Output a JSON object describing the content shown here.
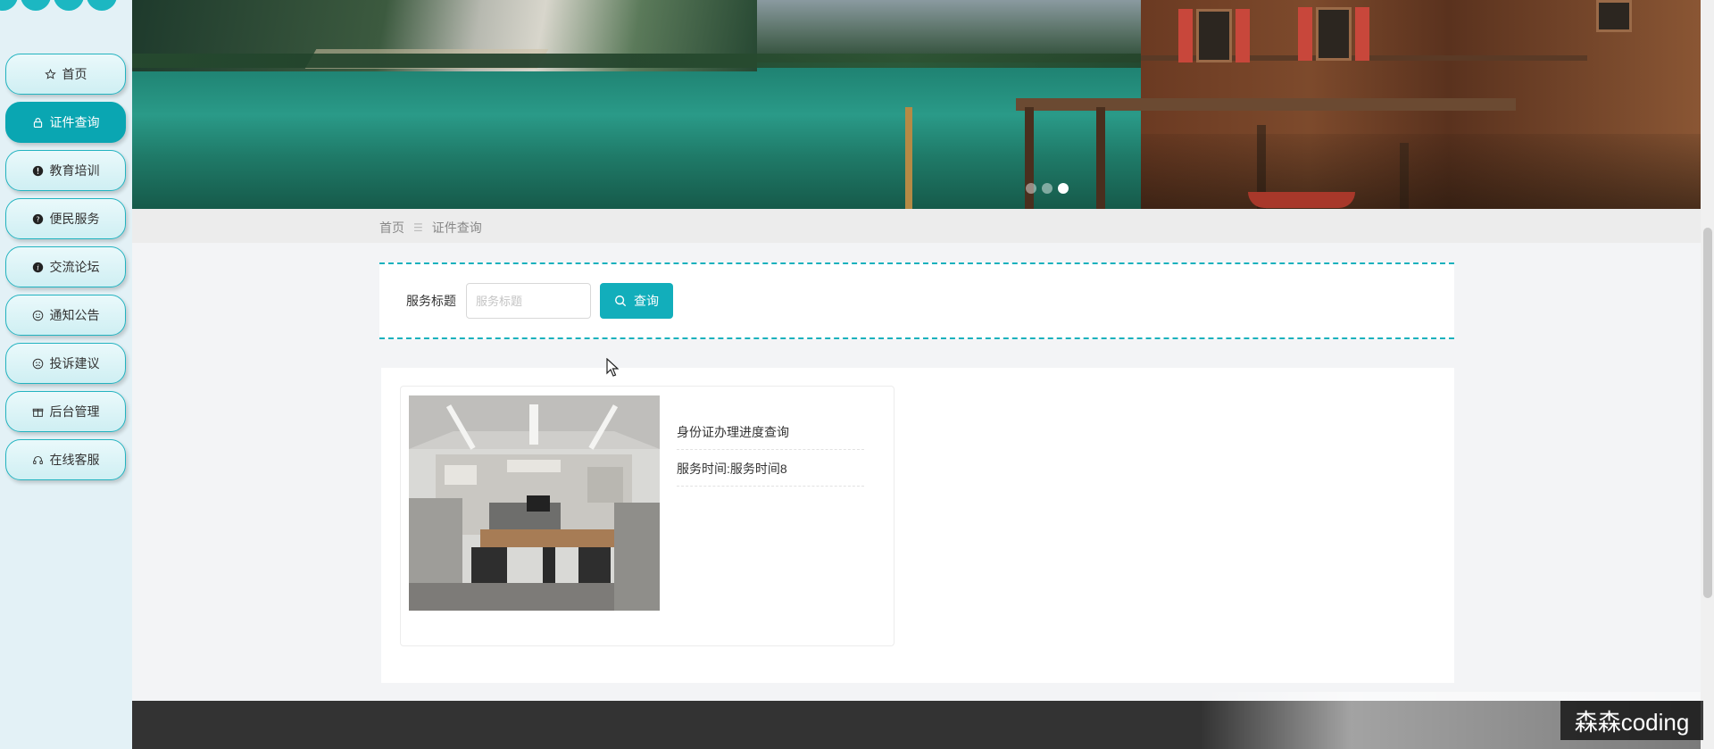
{
  "sidebar": {
    "items": [
      {
        "label": "首页",
        "icon": "star-icon"
      },
      {
        "label": "证件查询",
        "icon": "lock-icon",
        "active": true
      },
      {
        "label": "教育培训",
        "icon": "info-icon"
      },
      {
        "label": "便民服务",
        "icon": "help-icon"
      },
      {
        "label": "交流论坛",
        "icon": "info-icon"
      },
      {
        "label": "通知公告",
        "icon": "smile-icon"
      },
      {
        "label": "投诉建议",
        "icon": "feedback-icon"
      },
      {
        "label": "后台管理",
        "icon": "gift-icon"
      },
      {
        "label": "在线客服",
        "icon": "headset-icon"
      }
    ]
  },
  "breadcrumb": {
    "home": "首页",
    "separator": "☰",
    "current": "证件查询"
  },
  "search": {
    "label": "服务标题",
    "placeholder": "服务标题",
    "button_label": "查询"
  },
  "results": [
    {
      "title": "身份证办理进度查询",
      "time": "服务时间:服务时间8"
    }
  ],
  "carousel": {
    "count": 3,
    "active_index": 2
  },
  "watermark": "森森coding",
  "colors": {
    "accent": "#12aebb",
    "sidebar_bg": "#e3f1f6",
    "footer": "#333333"
  }
}
